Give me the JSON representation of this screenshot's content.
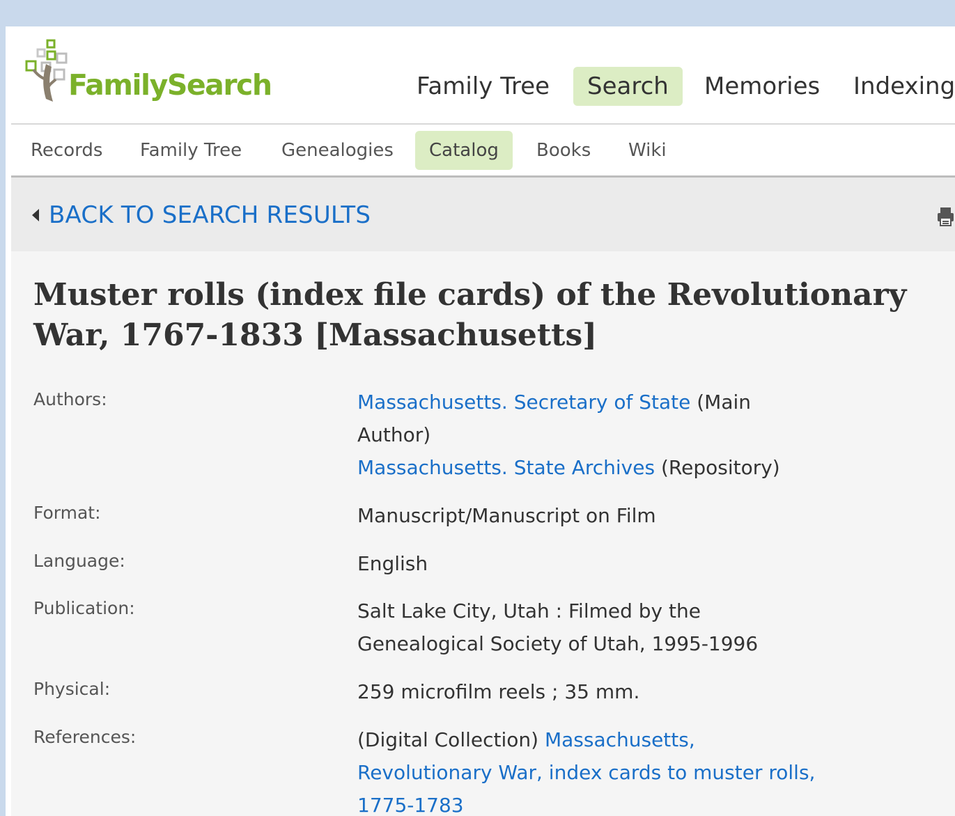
{
  "header": {
    "logo_text": "FamilySearch",
    "nav": [
      "Family Tree",
      "Search",
      "Memories",
      "Indexing"
    ],
    "active_nav": "Search"
  },
  "subnav": {
    "items": [
      "Records",
      "Family Tree",
      "Genealogies",
      "Catalog",
      "Books",
      "Wiki"
    ],
    "active": "Catalog"
  },
  "back_link": "BACK TO SEARCH RESULTS",
  "record": {
    "title": "Muster rolls (index file cards) of the Revolutionary War, 1767-1833 [Massachusetts]",
    "authors_label": "Authors:",
    "author1_link": "Massachusetts. Secretary of State",
    "author1_role": " (Main Author)",
    "author2_link": "Massachusetts. State Archives",
    "author2_role": " (Repository)",
    "format_label": "Format:",
    "format_value": "Manuscript/Manuscript on Film",
    "language_label": "Language:",
    "language_value": "English",
    "publication_label": "Publication:",
    "publication_value": "Salt Lake City, Utah : Filmed by the Genealogical Society of Utah, 1995-1996",
    "physical_label": "Physical:",
    "physical_value": "259 microfilm reels ; 35 mm.",
    "references_label": "References:",
    "references_prefix": "(Digital Collection) ",
    "references_link": "Massachusetts, Revolutionary War, index cards to muster rolls, 1775-1783"
  },
  "colors": {
    "brand_green": "#7bb12a",
    "active_tab_bg": "#dcedc4",
    "link_blue": "#1a6fc8",
    "outer_bg": "#c9d9ec"
  }
}
